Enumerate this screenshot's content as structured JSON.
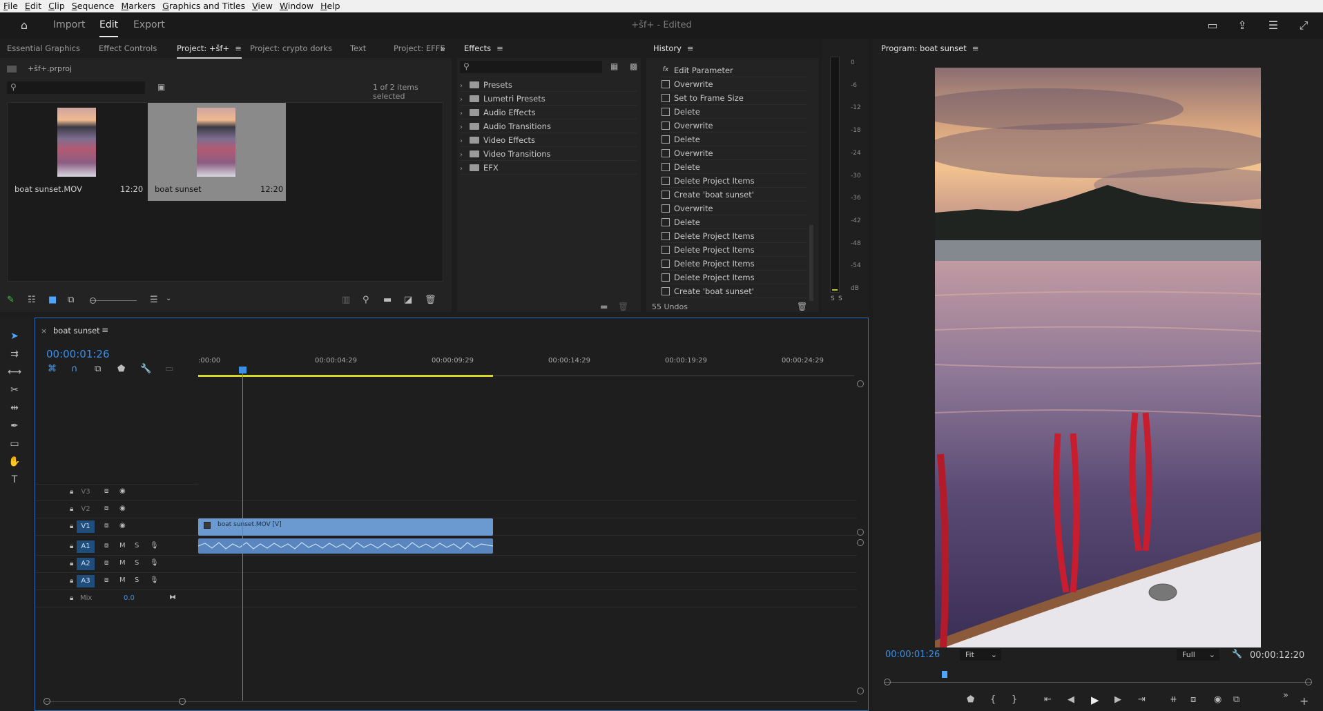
{
  "menu": [
    "File",
    "Edit",
    "Clip",
    "Sequence",
    "Markers",
    "Graphics and Titles",
    "View",
    "Window",
    "Help"
  ],
  "header": {
    "tabs": [
      "Import",
      "Edit",
      "Export"
    ],
    "active_tab": "Edit",
    "doc_title": "+šf+ - Edited"
  },
  "project_panel": {
    "tabs": [
      "Essential Graphics",
      "Effect Controls",
      "Project: +šf+",
      "Project: crypto dorks",
      "Text",
      "Project: EFFE"
    ],
    "active_tab": "Project: +šf+",
    "project_file": "+šf+.prproj",
    "selection_status": "1 of 2 items selected",
    "items": [
      {
        "name": "boat sunset.MOV",
        "duration": "12:20",
        "selected": false
      },
      {
        "name": "boat sunset",
        "duration": "12:20",
        "selected": true
      }
    ]
  },
  "effects_panel": {
    "title": "Effects",
    "items": [
      "Presets",
      "Lumetri Presets",
      "Audio Effects",
      "Audio Transitions",
      "Video Effects",
      "Video Transitions",
      "EFX"
    ]
  },
  "history_panel": {
    "title": "History",
    "items": [
      "Edit Parameter",
      "Overwrite",
      "Set to Frame Size",
      "Delete",
      "Overwrite",
      "Delete",
      "Overwrite",
      "Delete",
      "Delete Project Items",
      "Create 'boat sunset'",
      "Overwrite",
      "Delete",
      "Delete Project Items",
      "Delete Project Items",
      "Delete Project Items",
      "Delete Project Items",
      "Create 'boat sunset'"
    ],
    "undo_count": "55 Undos"
  },
  "audio_meter": {
    "ticks": [
      "0",
      "-6",
      "-12",
      "-18",
      "-24",
      "-30",
      "-36",
      "-42",
      "-48",
      "-54",
      "dB"
    ],
    "solo_labels": [
      "S",
      "S"
    ]
  },
  "program_monitor": {
    "title": "Program: boat sunset",
    "current_timecode": "00:00:01:26",
    "fit": "Fit",
    "quality": "Full",
    "duration_timecode": "00:00:12:20"
  },
  "timeline": {
    "sequence_name": "boat sunset",
    "timecode": "00:00:01:26",
    "ruler": [
      ":00:00",
      "00:00:04:29",
      "00:00:09:29",
      "00:00:14:29",
      "00:00:19:29",
      "00:00:24:29"
    ],
    "video_tracks": [
      "V3",
      "V2",
      "V1"
    ],
    "audio_tracks": [
      "A1",
      "A2",
      "A3"
    ],
    "mix_label": "Mix",
    "mix_value": "0.0",
    "video_clip": "boat sunset.MOV [V]",
    "mute_label": "M",
    "solo_label": "S"
  }
}
